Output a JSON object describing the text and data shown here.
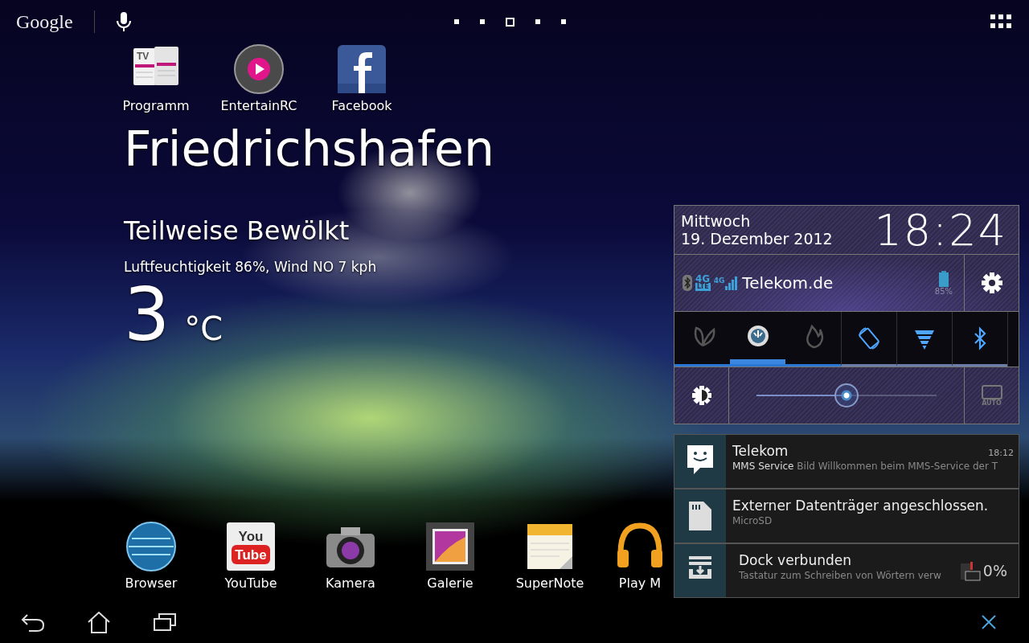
{
  "top_bar": {
    "search_logo": "Google",
    "pages": [
      {
        "selected": false
      },
      {
        "selected": false
      },
      {
        "selected": true
      },
      {
        "selected": false
      },
      {
        "selected": false
      }
    ]
  },
  "shortcuts": [
    {
      "kind": "tv",
      "label": "Programm",
      "icon_text": [
        "TV"
      ]
    },
    {
      "kind": "remote",
      "label": "EntertainRC"
    },
    {
      "kind": "facebook",
      "label": "Facebook"
    }
  ],
  "weather": {
    "city": "Friedrichshafen",
    "condition": "Teilweise Bewölkt",
    "details": "Luftfeuchtigkeit 86%, Wind NO 7 kph",
    "temperature": "3",
    "unit": "°C"
  },
  "dock": [
    {
      "kind": "browser",
      "label": "Browser"
    },
    {
      "kind": "youtube",
      "label": "YouTube",
      "icon_text": [
        "You",
        "Tube"
      ]
    },
    {
      "kind": "camera",
      "label": "Kamera"
    },
    {
      "kind": "gallery",
      "label": "Galerie"
    },
    {
      "kind": "note",
      "label": "SuperNote"
    },
    {
      "kind": "music",
      "label": "Play M"
    }
  ],
  "quick_panel": {
    "weekday": "Mittwoch",
    "date": "19. Dezember 2012",
    "time": "18:24",
    "status": {
      "network_type": "4G",
      "lte_label": "LTE",
      "signal_label": "4G",
      "carrier": "Telekom.de",
      "battery": "85%"
    },
    "power_modes": [
      {
        "kind": "saving",
        "selected": false
      },
      {
        "kind": "balanced",
        "selected": true
      },
      {
        "kind": "performance",
        "selected": false
      }
    ],
    "toggles": [
      {
        "kind": "rotation",
        "on": true
      },
      {
        "kind": "wifi",
        "on": true
      },
      {
        "kind": "bluetooth",
        "on": true
      }
    ],
    "brightness": {
      "level": 0.5,
      "auto_label": "AUTO",
      "auto": false
    }
  },
  "notifications": [
    {
      "kind": "message",
      "title": "Telekom",
      "time": "18:12",
      "text": "**MMS Service** Bild Willkommen beim MMS-Service der T"
    },
    {
      "kind": "sdcard",
      "title": "Externer Datenträger angeschlossen.",
      "text": "MicroSD"
    },
    {
      "kind": "dock",
      "title": "Dock verbunden",
      "text": "Tastatur zum Schreiben von Wörtern verw",
      "battery": "0%"
    }
  ]
}
